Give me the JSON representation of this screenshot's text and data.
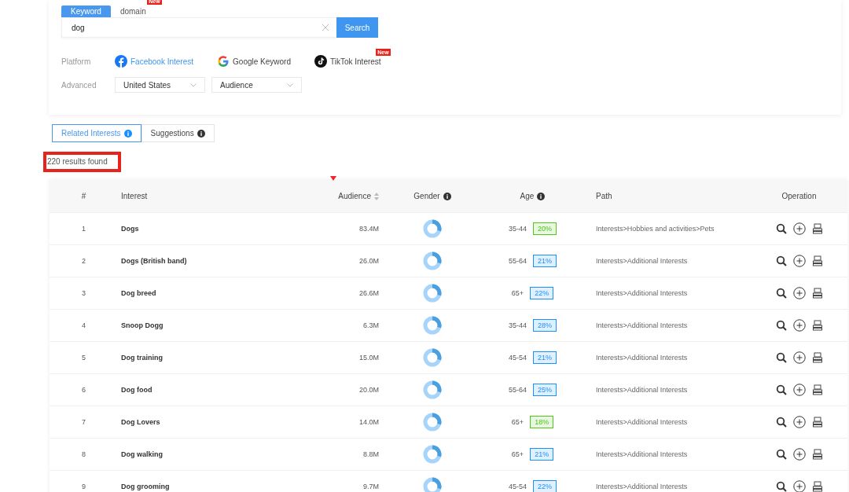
{
  "search_tabs": [
    {
      "label": "Keyword",
      "selected": true
    },
    {
      "label": "domain",
      "selected": false,
      "badge": "New"
    }
  ],
  "search": {
    "value": "dog",
    "button": "Search"
  },
  "platform": {
    "label": "Platform",
    "options": [
      {
        "kind": "facebook",
        "label": "Facebook Interest",
        "selected": true
      },
      {
        "kind": "google",
        "label": "Google Keyword",
        "selected": false
      },
      {
        "kind": "tiktok",
        "label": "TikTok Interest",
        "selected": false,
        "badge": "New"
      }
    ]
  },
  "advanced": {
    "label": "Advanced",
    "selects": [
      "United States",
      "Audience"
    ]
  },
  "result_tabs": [
    {
      "label": "Related Interests",
      "selected": true
    },
    {
      "label": "Suggestions",
      "selected": false
    }
  ],
  "results_count": "220 results found",
  "table": {
    "columns": [
      {
        "label": "#",
        "kind": "plain"
      },
      {
        "label": "Interest",
        "kind": "plain"
      },
      {
        "label": "Audience",
        "kind": "sort"
      },
      {
        "label": "Gender",
        "kind": "info"
      },
      {
        "label": "Age",
        "kind": "info"
      },
      {
        "label": "Path",
        "kind": "plain"
      },
      {
        "label": "Operation",
        "kind": "plain"
      }
    ],
    "rows": [
      {
        "index": "1",
        "interest": "Dogs",
        "audience": "83.4M",
        "age": "35-44",
        "age_share": "20%",
        "color": "#52c41a",
        "path": "Interests>Hobbies and activities>Pets"
      },
      {
        "index": "2",
        "interest": "Dogs (British band)",
        "audience": "26.0M",
        "age": "55-64",
        "age_share": "21%",
        "color": "#1890ff",
        "path": "Interests>Additional Interests"
      },
      {
        "index": "3",
        "interest": "Dog breed",
        "audience": "26.6M",
        "age": "65+",
        "age_share": "22%",
        "color": "#1890ff",
        "path": "Interests>Additional Interests"
      },
      {
        "index": "4",
        "interest": "Snoop Dogg",
        "audience": "6.3M",
        "age": "35-44",
        "age_share": "28%",
        "color": "#1890ff",
        "path": "Interests>Additional Interests"
      },
      {
        "index": "5",
        "interest": "Dog training",
        "audience": "15.0M",
        "age": "45-54",
        "age_share": "21%",
        "color": "#1890ff",
        "path": "Interests>Additional Interests"
      },
      {
        "index": "6",
        "interest": "Dog food",
        "audience": "20.0M",
        "age": "55-64",
        "age_share": "25%",
        "color": "#1890ff",
        "path": "Interests>Additional Interests"
      },
      {
        "index": "7",
        "interest": "Dog Lovers",
        "audience": "14.0M",
        "age": "65+",
        "age_share": "18%",
        "color": "#52c41a",
        "path": "Interests>Additional Interests"
      },
      {
        "index": "8",
        "interest": "Dog walking",
        "audience": "8.8M",
        "age": "65+",
        "age_share": "21%",
        "color": "#1890ff",
        "path": "Interests>Additional Interests"
      },
      {
        "index": "9",
        "interest": "Dog grooming",
        "audience": "9.7M",
        "age": "45-54",
        "age_share": "22%",
        "color": "#1890ff",
        "path": "Interests>Additional Interests"
      }
    ]
  }
}
